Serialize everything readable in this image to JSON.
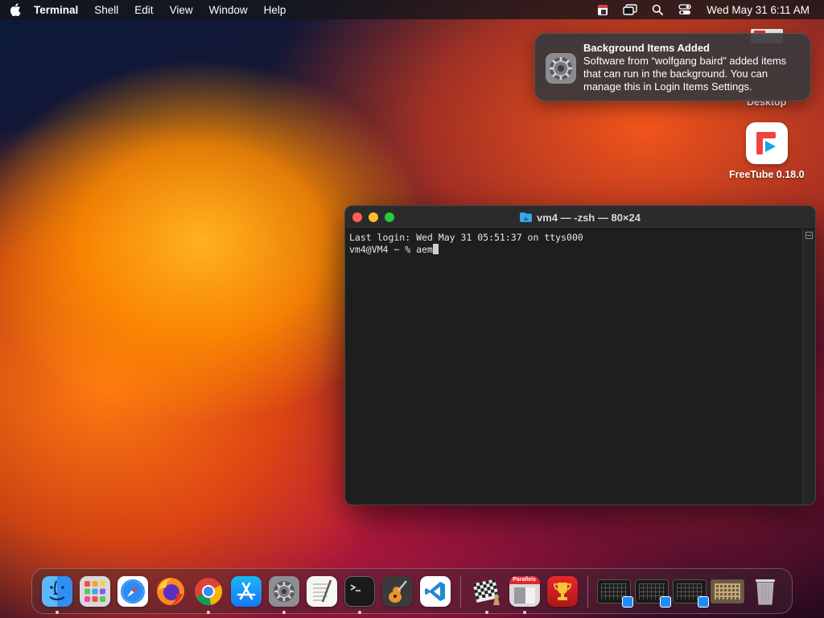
{
  "menubar": {
    "app_name": "Terminal",
    "menus": [
      "Shell",
      "Edit",
      "View",
      "Window",
      "Help"
    ],
    "clock": "Wed May 31  6:11 AM",
    "status_icons": [
      "calendar-icon",
      "screen-mirroring-icon",
      "search-icon",
      "control-center-icon"
    ]
  },
  "desktop": {
    "items": [
      {
        "label": "Desktop",
        "icon": "folder-icon"
      },
      {
        "label": "FreeTube 0.18.0",
        "icon": "freetube-app-icon"
      }
    ]
  },
  "notification": {
    "title": "Background Items Added",
    "body": "Software from “wolfgang baird” added items that can run in the background. You can manage this in Login Items Settings.",
    "icon": "system-settings-gear-icon"
  },
  "terminal": {
    "title": "vm4 — -zsh — 80×24",
    "lines": [
      "Last login: Wed May 31 05:51:37 on ttys000",
      "vm4@VM4 ~ % aem"
    ]
  },
  "dock": {
    "apps": [
      {
        "name": "Finder",
        "icon": "finder-icon",
        "running": true
      },
      {
        "name": "Launchpad",
        "icon": "launchpad-icon",
        "running": false
      },
      {
        "name": "Safari",
        "icon": "safari-icon",
        "running": false
      },
      {
        "name": "Firefox",
        "icon": "firefox-icon",
        "running": false
      },
      {
        "name": "Google Chrome",
        "icon": "chrome-icon",
        "running": true
      },
      {
        "name": "App Store",
        "icon": "app-store-icon",
        "running": false
      },
      {
        "name": "System Settings",
        "icon": "system-settings-icon",
        "running": true
      },
      {
        "name": "TextEdit",
        "icon": "textedit-icon",
        "running": false
      },
      {
        "name": "Terminal",
        "icon": "terminal-icon",
        "running": true
      },
      {
        "name": "GarageBand",
        "icon": "garageband-icon",
        "running": false
      },
      {
        "name": "Visual Studio Code",
        "icon": "vscode-icon",
        "running": false
      },
      {
        "name": "Chess",
        "icon": "chess-icon",
        "running": true
      },
      {
        "name": "Parallels",
        "icon": "parallels-icon",
        "running": true
      },
      {
        "name": "Trophy",
        "icon": "trophy-icon",
        "running": false
      }
    ],
    "parallels_label": "Parallels",
    "windows": [
      "minimized-window-1",
      "minimized-window-2",
      "minimized-window-3",
      "minimized-window-4"
    ],
    "trash": "trash-icon"
  }
}
